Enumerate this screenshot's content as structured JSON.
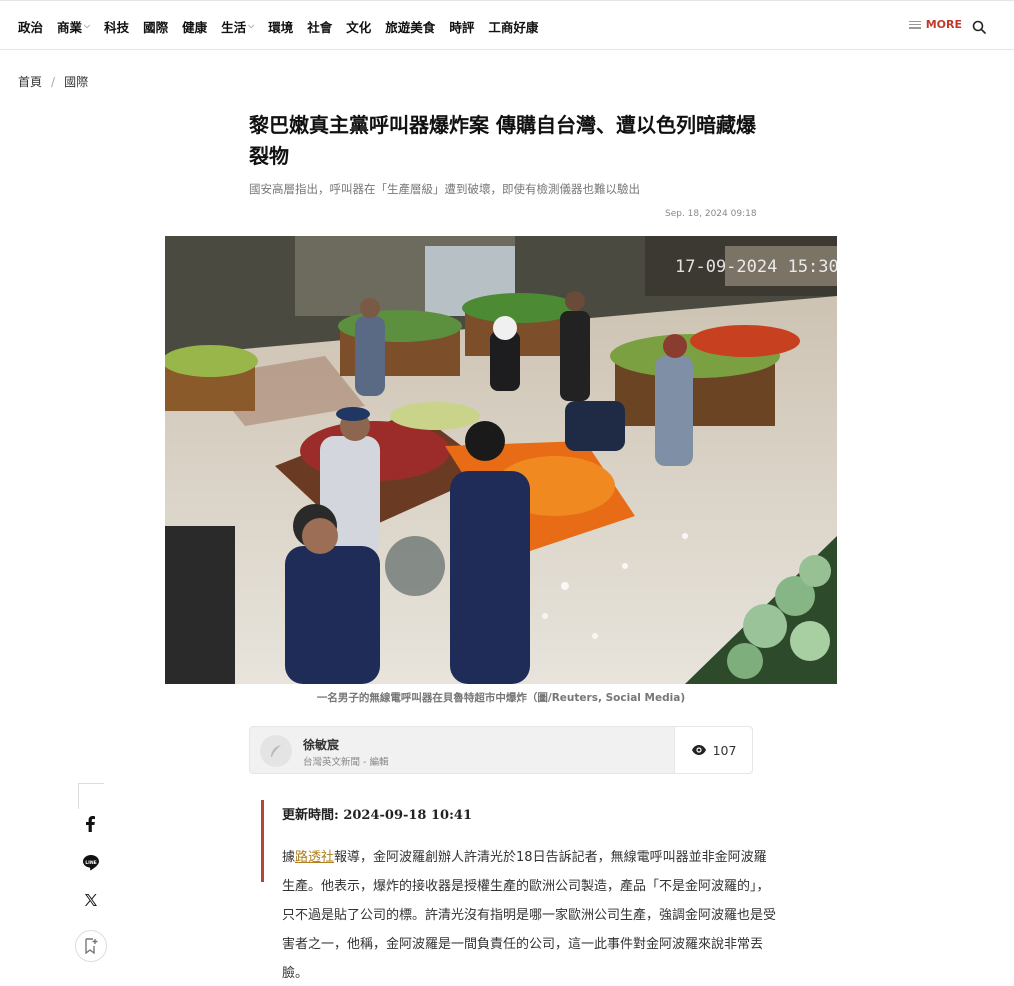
{
  "nav": {
    "items": [
      {
        "label": "政治",
        "has_dropdown": false
      },
      {
        "label": "商業",
        "has_dropdown": true
      },
      {
        "label": "科技",
        "has_dropdown": false
      },
      {
        "label": "國際",
        "has_dropdown": false
      },
      {
        "label": "健康",
        "has_dropdown": false
      },
      {
        "label": "生活",
        "has_dropdown": true
      },
      {
        "label": "環境",
        "has_dropdown": false
      },
      {
        "label": "社會",
        "has_dropdown": false
      },
      {
        "label": "文化",
        "has_dropdown": false
      },
      {
        "label": "旅遊美食",
        "has_dropdown": false
      },
      {
        "label": "時評",
        "has_dropdown": false
      },
      {
        "label": "工商好康",
        "has_dropdown": false
      }
    ],
    "more_label": "MORE"
  },
  "breadcrumb": {
    "home": "首頁",
    "separator": "/",
    "section": "國際"
  },
  "article": {
    "headline": "黎巴嫩真主黨呼叫器爆炸案 傳購自台灣、遭以色列暗藏爆裂物",
    "dek": "國安高層指出，呼叫器在「生產層級」遭到破壞，即使有檢測儀器也難以驗出",
    "date": "Sep. 18, 2024 09:18",
    "image_overlay_timestamp": "17-09-2024 15:30",
    "image_caption": "一名男子的無線電呼叫器在貝魯特超市中爆炸（圖/Reuters, Social Media)",
    "author_name": "徐敏宸",
    "author_org": "台灣英文新聞 - 編輯",
    "views": "107",
    "updated": "更新時間: 2024-09-18 10:41",
    "body_prefix": "據",
    "body_link": "路透社",
    "body_rest": "報導，金阿波羅創辦人許清光於18日告訴記者，無線電呼叫器並非金阿波羅生產。他表示，爆炸的接收器是授權生產的歐洲公司製造，產品「不是金阿波羅的」，只不過是貼了公司的標。許清光沒有指明是哪一家歐洲公司生產，強調金阿波羅也是受害者之一，他稱，金阿波羅是一間負責任的公司，這一此事件對金阿波羅來說非常丟臉。"
  },
  "share": {
    "icons": [
      "facebook-icon",
      "line-icon",
      "x-icon",
      "bookmark-icon"
    ]
  },
  "colors": {
    "accent": "#c0392b",
    "update_bar": "#b3463a",
    "link": "#b07f1e"
  }
}
